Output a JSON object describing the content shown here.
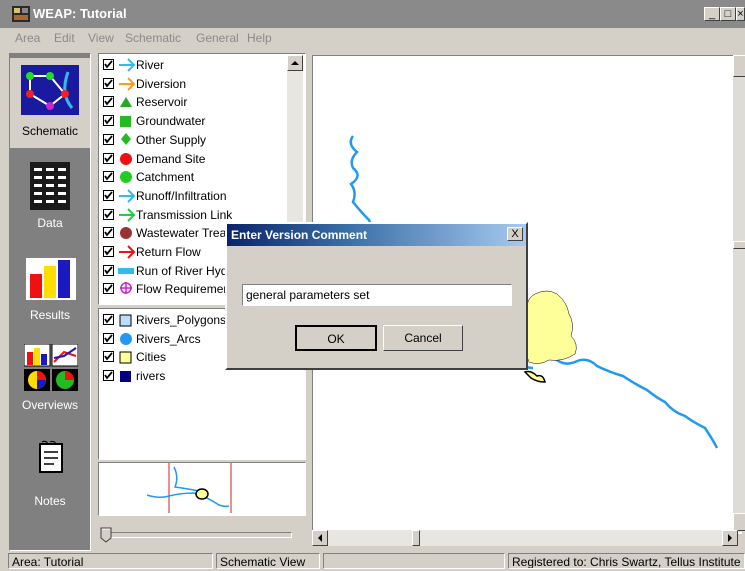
{
  "window": {
    "title": "WEAP: Tutorial"
  },
  "menu": [
    "Area",
    "Edit",
    "View",
    "Schematic",
    "General",
    "Help"
  ],
  "nav": [
    {
      "label": "Schematic",
      "icon": "schematic-icon",
      "active": true
    },
    {
      "label": "Data",
      "icon": "data-icon"
    },
    {
      "label": "Results",
      "icon": "results-icon"
    },
    {
      "label": "Overviews",
      "icon": "overviews-icon"
    },
    {
      "label": "Notes",
      "icon": "notes-icon"
    }
  ],
  "layers": [
    {
      "label": "River",
      "symbol": "arrow",
      "color": "#33bbee"
    },
    {
      "label": "Diversion",
      "symbol": "arrow",
      "color": "#ff9922"
    },
    {
      "label": "Reservoir",
      "symbol": "triangle",
      "color": "#22aa22"
    },
    {
      "label": "Groundwater",
      "symbol": "square",
      "color": "#22bb22"
    },
    {
      "label": "Other Supply",
      "symbol": "diamond",
      "color": "#22bb22"
    },
    {
      "label": "Demand Site",
      "symbol": "circle",
      "color": "#ee1111"
    },
    {
      "label": "Catchment",
      "symbol": "circle",
      "color": "#22cc22"
    },
    {
      "label": "Runoff/Infiltration",
      "symbol": "arrow",
      "color": "#33bbee"
    },
    {
      "label": "Transmission Link",
      "symbol": "arrow",
      "color": "#22cc44"
    },
    {
      "label": "Wastewater Trea",
      "symbol": "circle",
      "color": "#993333"
    },
    {
      "label": "Return Flow",
      "symbol": "arrow",
      "color": "#ee1111"
    },
    {
      "label": "Run of River Hyd",
      "symbol": "bar",
      "color": "#33bbee"
    },
    {
      "label": "Flow Requiremen",
      "symbol": "target",
      "color": "#cc22cc"
    }
  ],
  "gis_layers": [
    {
      "label": "Rivers_Polygons",
      "color": "#bbddff",
      "symbol": "square-outline"
    },
    {
      "label": "Rivers_Arcs",
      "color": "#2299ee",
      "symbol": "circle"
    },
    {
      "label": "Cities",
      "color": "#ffff99",
      "symbol": "square-outline"
    },
    {
      "label": "rivers",
      "color": "#000080",
      "symbol": "square"
    }
  ],
  "dialog": {
    "title": "Enter Version Comment",
    "input_value": "general parameters set",
    "ok_label": "OK",
    "cancel_label": "Cancel",
    "close_label": "X"
  },
  "status": {
    "area": "Area: Tutorial",
    "view": "Schematic View",
    "empty": "",
    "registered": "Registered to: Chris Swartz, Tellus Institute ,"
  },
  "colors": {
    "river": "#2299ee",
    "city": "#ffff99",
    "dialog_title_start": "#0a246a"
  }
}
